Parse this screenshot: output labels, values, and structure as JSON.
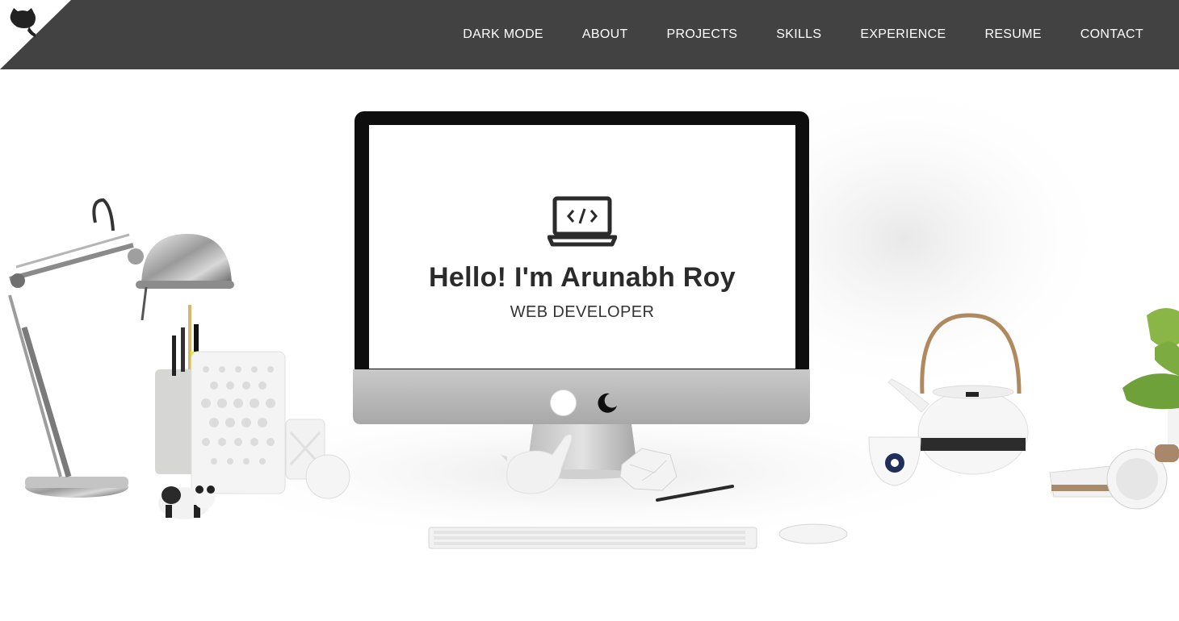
{
  "nav": {
    "items": [
      {
        "label": "DARK MODE"
      },
      {
        "label": "ABOUT"
      },
      {
        "label": "PROJECTS"
      },
      {
        "label": "SKILLS"
      },
      {
        "label": "EXPERIENCE"
      },
      {
        "label": "RESUME"
      },
      {
        "label": "CONTACT"
      }
    ],
    "corner_icon": "github-octocat-icon"
  },
  "hero": {
    "icon": "laptop-code-icon",
    "title": "Hello! I'm Arunabh Roy",
    "subtitle": "WEB DEVELOPER",
    "toggle_light_icon": "light-mode-circle-icon",
    "toggle_dark_icon": "moon-icon"
  },
  "colors": {
    "navbar": "#424242",
    "nav_text": "#ffffff",
    "title_text": "#2b2b2b",
    "page_bg": "#ffffff"
  }
}
